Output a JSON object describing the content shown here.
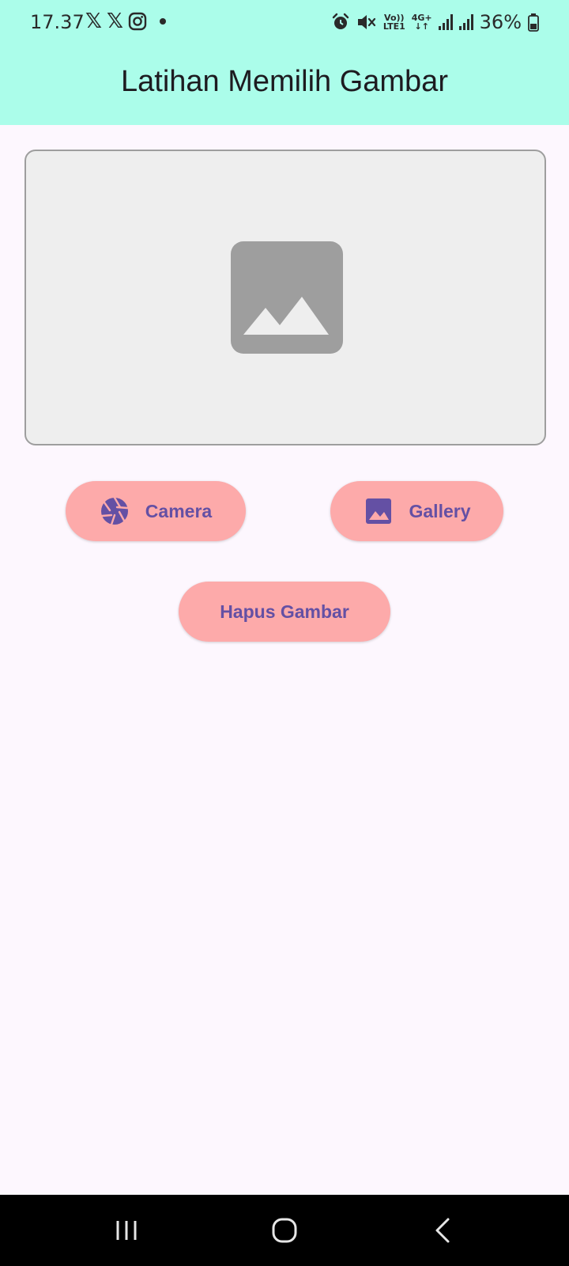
{
  "status_bar": {
    "time": "17.37",
    "notification_icons": [
      "x-icon",
      "x-icon",
      "instagram-icon",
      "dot-icon"
    ],
    "x_glyph": "𝕏",
    "network_top": "Vo))",
    "network_bottom": "LTE1",
    "data_type": "4G+",
    "data_arrows": "↓↑",
    "battery": "36%",
    "right_icons": [
      "alarm-icon",
      "mute-icon",
      "volte-icon",
      "data-4g-icon",
      "signal-icon",
      "signal-icon",
      "battery-icon"
    ]
  },
  "app_bar": {
    "title": "Latihan Memilih Gambar",
    "background": "#abfdea"
  },
  "preview": {
    "icon": "image-placeholder-icon",
    "background": "#eeeeee",
    "border": "#9e9e9e"
  },
  "buttons": {
    "camera": {
      "label": "Camera",
      "icon": "camera-shutter-icon"
    },
    "gallery": {
      "label": "Gallery",
      "icon": "image-icon"
    },
    "hapus": {
      "label": "Hapus Gambar"
    }
  },
  "button_style": {
    "background": "#fdaaaa",
    "foreground": "#6450a4"
  },
  "nav_bar": {
    "items": [
      "recents-icon",
      "home-icon",
      "back-icon"
    ]
  }
}
